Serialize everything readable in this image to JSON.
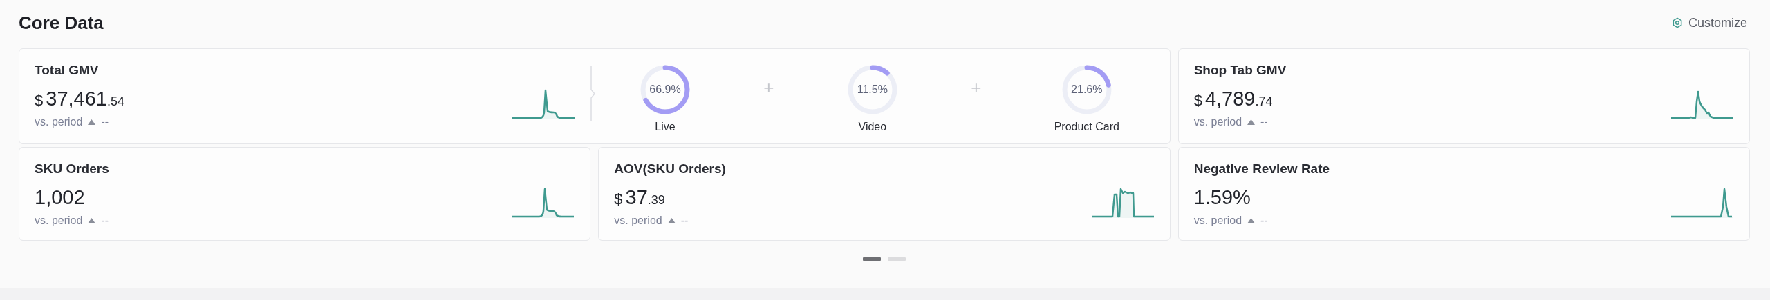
{
  "header": {
    "title": "Core Data",
    "customize": {
      "label": "Customize"
    }
  },
  "featured": {
    "title": "Total GMV",
    "currency": "$",
    "value": "37,461",
    "decimals": ".54",
    "comparison": "vs. period",
    "change": "--",
    "breakdown": [
      {
        "label": "Live",
        "percent": "66.9%"
      },
      {
        "label": "Video",
        "percent": "11.5%"
      },
      {
        "label": "Product Card",
        "percent": "21.6%"
      }
    ],
    "separator": "+"
  },
  "metrics": [
    {
      "title": "Shop Tab GMV",
      "currency": "$",
      "value": "4,789",
      "decimals": ".74",
      "comparison": "vs. period",
      "change": "--"
    },
    {
      "title": "SKU Orders",
      "value": "1,002",
      "comparison": "vs. period",
      "change": "--"
    },
    {
      "title": "AOV(SKU Orders)",
      "currency": "$",
      "value": "37",
      "decimals": ".39",
      "comparison": "vs. period",
      "change": "--"
    },
    {
      "title": "Negative Review Rate",
      "value": "1.59%",
      "comparison": "vs. period",
      "change": "--"
    }
  ],
  "pages": [
    {
      "selected": true
    },
    {
      "selected": false
    }
  ]
}
